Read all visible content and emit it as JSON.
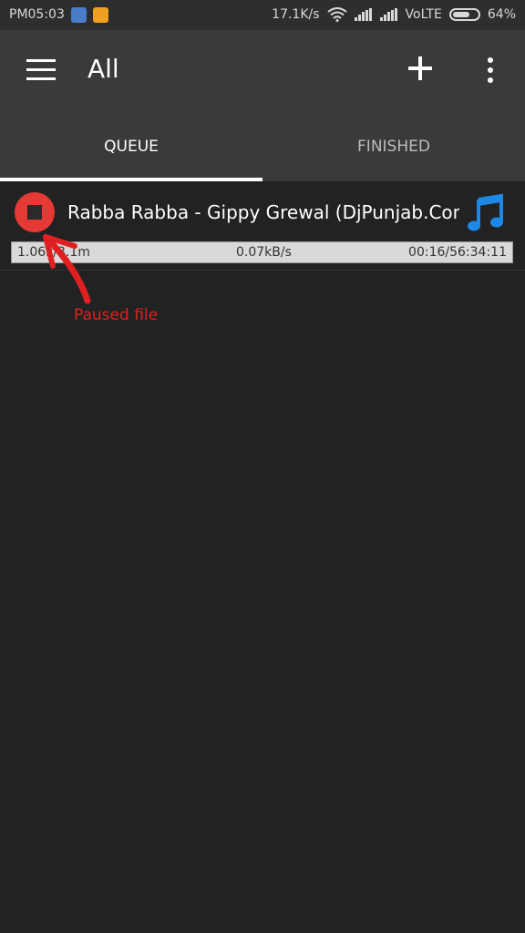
{
  "status_bar": {
    "time": "PM05:03",
    "net_speed": "17.1K/s",
    "network": "VoLTE",
    "battery": "64%",
    "battery_level": 0.64
  },
  "toolbar": {
    "title": "All",
    "menu_icon": "hamburger-icon",
    "add_icon": "plus-icon",
    "more_icon": "more-vert-icon"
  },
  "tabs": [
    {
      "label": "QUEUE",
      "active": true
    },
    {
      "label": "FINISHED",
      "active": false
    }
  ],
  "downloads": [
    {
      "name": "Rabba Rabba - Gippy Grewal (DjPunjab.Com)....",
      "state": "paused",
      "type_icon": "music-note-icon",
      "size_text": "1.06k/3.1m",
      "speed": "0.07kB/s",
      "time": "00:16/56:34:11",
      "progress": 0.0
    }
  ],
  "annotation": {
    "text": "Paused file",
    "color": "#e02020"
  },
  "colors": {
    "accent_red": "#e53935",
    "music_blue": "#1e88e5",
    "toolbar": "#3a3a3a",
    "background": "#222222"
  }
}
